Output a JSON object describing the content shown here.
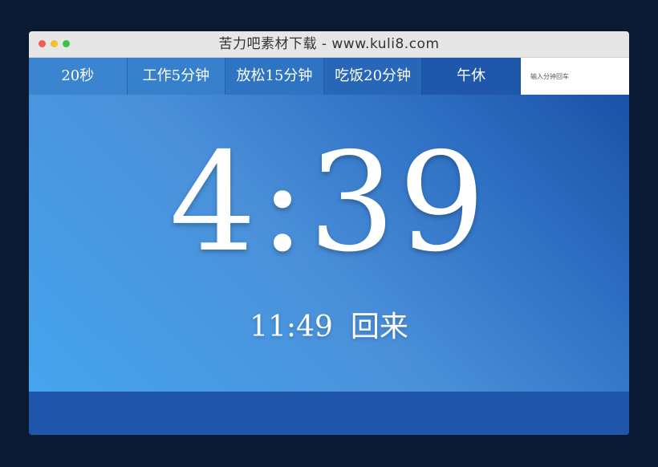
{
  "window": {
    "title": "苦力吧素材下载 - www.kuli8.com",
    "dot_colors": [
      "#f25c54",
      "#f4bf2e",
      "#3dc343"
    ]
  },
  "tabs": [
    {
      "label": "20秒"
    },
    {
      "label": "工作5分钟"
    },
    {
      "label": "放松15分钟"
    },
    {
      "label": "吃饭20分钟"
    },
    {
      "label": "午休"
    }
  ],
  "minutes_input": {
    "value": "",
    "placeholder": "输入分钟回车"
  },
  "timer": {
    "countdown": "4:39",
    "return_time": "11:49",
    "return_label": "回来"
  },
  "colors": {
    "background": "#0b1a33",
    "main_gradient_start": "#45a5ee",
    "main_gradient_end": "#1a52a8",
    "footer": "#1f56ab"
  }
}
